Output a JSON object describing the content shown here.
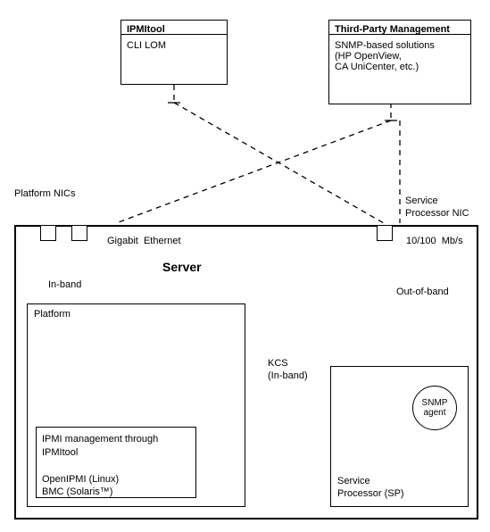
{
  "top_boxes": {
    "ipmitool": {
      "title": "IPMItool",
      "body": "CLI LOM"
    },
    "third_party": {
      "title": "Third-Party Management",
      "body": "SNMP-based solutions\n(HP OpenView,\nCA UniCenter, etc.)"
    }
  },
  "labels": {
    "platform_nics": "Platform NICs",
    "service_proc_nic": "Service\nProcessor NIC",
    "gigabit": "Gigabit  Ethernet",
    "link_speed": "10/100  Mb/s",
    "server": "Server",
    "in_band": "In-band",
    "out_of_band": "Out-of-band",
    "kcs": "KCS\n(In-band)"
  },
  "platform_box": {
    "title": "Platform",
    "inner": "IPMI management through\nIPMItool\n\nOpenIPMI (Linux)\nBMC (Solaris™)"
  },
  "sp_box": {
    "title": "Service\nProcessor (SP)",
    "snmp": "SNMP\nagent"
  }
}
